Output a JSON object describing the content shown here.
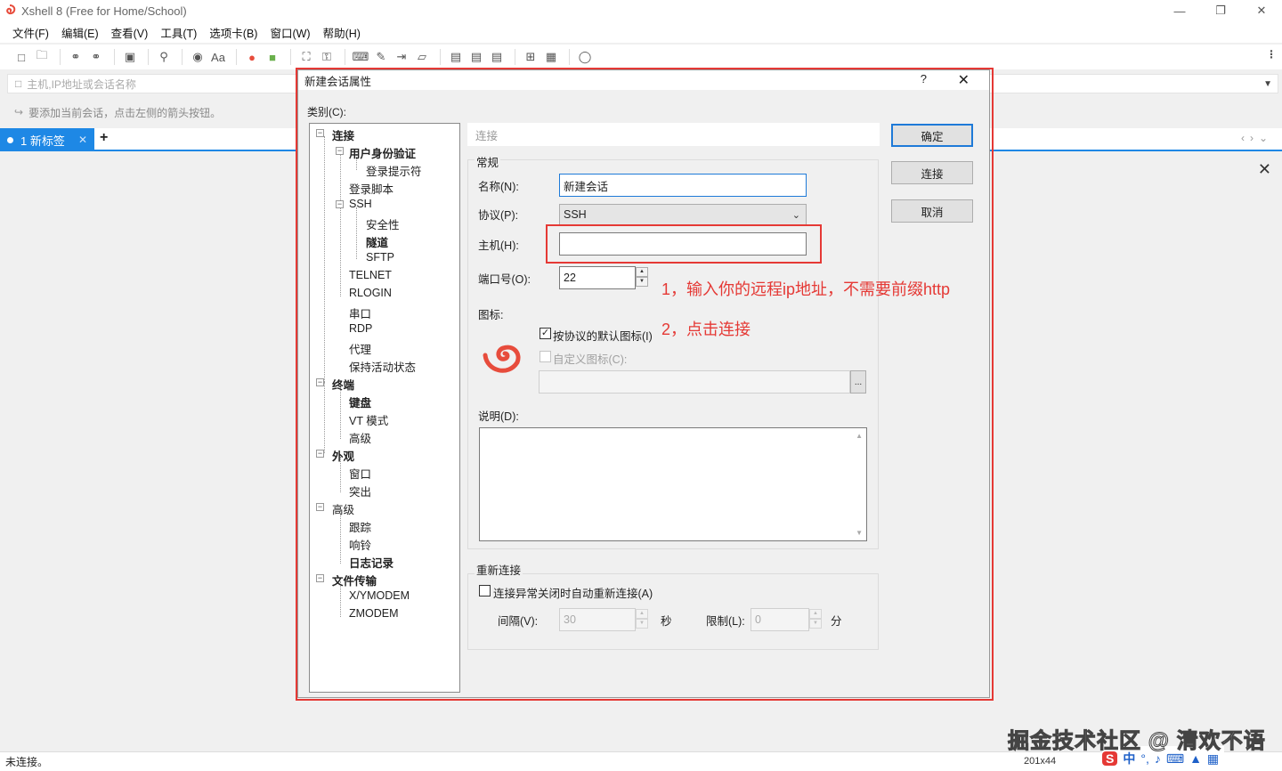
{
  "window": {
    "title": "Xshell 8 (Free for Home/School)"
  },
  "menu": [
    "文件(F)",
    "编辑(E)",
    "查看(V)",
    "工具(T)",
    "选项卡(B)",
    "窗口(W)",
    "帮助(H)"
  ],
  "address": {
    "placeholder": "主机,IP地址或会话名称"
  },
  "hint": "要添加当前会话，点击左侧的箭头按钮。",
  "tab": {
    "label": "1 新标签"
  },
  "status": {
    "text": "未连接。",
    "size": "201x44"
  },
  "watermark": "掘金技术社区 @ 清欢不语",
  "ime": {
    "lang": "中"
  },
  "dialog": {
    "title": "新建会话属性",
    "help": "?",
    "category_label": "类别(C):",
    "tree": [
      {
        "label": "连接",
        "bold": true
      },
      {
        "label": "用户身份验证",
        "bold": true
      },
      {
        "label": "登录提示符",
        "bold": false
      },
      {
        "label": "登录脚本",
        "bold": false
      },
      {
        "label": "SSH",
        "bold": false
      },
      {
        "label": "安全性",
        "bold": false
      },
      {
        "label": "隧道",
        "bold": true
      },
      {
        "label": "SFTP",
        "bold": false
      },
      {
        "label": "TELNET",
        "bold": false
      },
      {
        "label": "RLOGIN",
        "bold": false
      },
      {
        "label": "串口",
        "bold": false
      },
      {
        "label": "RDP",
        "bold": false
      },
      {
        "label": "代理",
        "bold": false
      },
      {
        "label": "保持活动状态",
        "bold": false
      },
      {
        "label": "终端",
        "bold": true
      },
      {
        "label": "键盘",
        "bold": true
      },
      {
        "label": "VT 模式",
        "bold": false
      },
      {
        "label": "高级",
        "bold": false
      },
      {
        "label": "外观",
        "bold": true
      },
      {
        "label": "窗口",
        "bold": false
      },
      {
        "label": "突出",
        "bold": false
      },
      {
        "label": "高级",
        "bold": false
      },
      {
        "label": "跟踪",
        "bold": false
      },
      {
        "label": "响铃",
        "bold": false
      },
      {
        "label": "日志记录",
        "bold": true
      },
      {
        "label": "文件传输",
        "bold": true
      },
      {
        "label": "X/YMODEM",
        "bold": false
      },
      {
        "label": "ZMODEM",
        "bold": false
      }
    ],
    "path": "连接",
    "general": {
      "group_label": "常规",
      "name_label": "名称(N):",
      "name_value": "新建会话",
      "protocol_label": "协议(P):",
      "protocol_value": "SSH",
      "host_label": "主机(H):",
      "host_value": "",
      "port_label": "端口号(O):",
      "port_value": "22",
      "icon_label": "图标:",
      "use_default_icon": "按协议的默认图标(I)",
      "custom_icon": "自定义图标(C):",
      "browse": "...",
      "desc_label": "说明(D):"
    },
    "reconnect": {
      "group_label": "重新连接",
      "auto_reconnect": "连接异常关闭时自动重新连接(A)",
      "interval_label": "间隔(V):",
      "interval_value": "30",
      "interval_unit": "秒",
      "limit_label": "限制(L):",
      "limit_value": "0",
      "limit_unit": "分"
    },
    "buttons": {
      "ok": "确定",
      "connect": "连接",
      "cancel": "取消"
    }
  },
  "annotations": {
    "step1": "1，输入你的远程ip地址，不需要前缀http",
    "step2": "2，点击连接"
  },
  "colors": {
    "accent": "#1e88e5",
    "annotation": "#e53935",
    "logo": "#e74c3c"
  }
}
